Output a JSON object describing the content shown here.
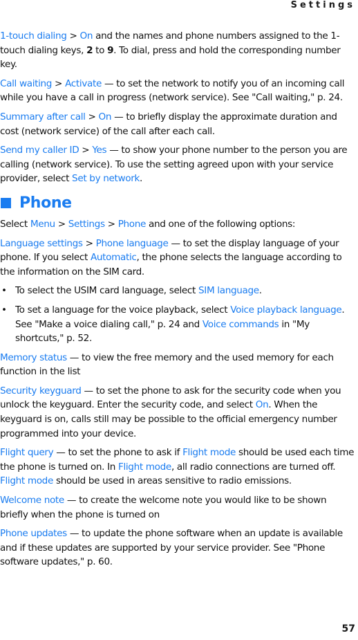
{
  "header": {
    "running_title": "Settings"
  },
  "footer": {
    "page_number": "57"
  },
  "paragraphs": {
    "touch_dialing": {
      "term": "1-touch dialing",
      "sep": " > ",
      "value": "On",
      "text1": " and the names and phone numbers assigned to the 1-touch dialing keys, ",
      "key_from": "2",
      "text2": " to ",
      "key_to": "9",
      "text3": ". To dial, press and hold the corresponding number key."
    },
    "call_waiting": {
      "term": "Call waiting",
      "sep": " > ",
      "value": "Activate",
      "text": " — to set the network to notify you of an incoming call while you have a call in progress (network service). See \"Call waiting,\" p. 24."
    },
    "summary_after_call": {
      "term": "Summary after call",
      "sep": " > ",
      "value": "On",
      "text": " — to briefly display the approximate duration and cost (network service) of the call after each call."
    },
    "send_caller_id": {
      "term": "Send my caller ID",
      "sep": " > ",
      "value": "Yes",
      "text1": " — to show your phone number to the person you are calling (network service). To use the setting agreed upon with your service provider, select ",
      "option": "Set by network",
      "text2": "."
    }
  },
  "section": {
    "heading": "Phone",
    "intro": {
      "text1": "Select ",
      "menu": "Menu",
      "sep": " > ",
      "settings": "Settings",
      "phone": "Phone",
      "text2": " and one of the following options:"
    },
    "language": {
      "term": "Language settings",
      "sep": " > ",
      "value": "Phone language",
      "text1": " — to set the display language of your phone. If you select ",
      "option": "Automatic",
      "text2": ", the phone selects the language according to the information on the SIM card."
    },
    "bullets": [
      {
        "dot": "•",
        "text1": "To select the USIM card language, select ",
        "link1": "SIM language",
        "text2": "."
      },
      {
        "dot": "•",
        "text1": "To set a language for the voice playback, select ",
        "link1": "Voice playback language",
        "text2": ". See \"Make a voice dialing call,\" p. 24 and ",
        "link2": "Voice commands",
        "text3": " in \"My shortcuts,\" p. 52."
      }
    ],
    "memory_status": {
      "term": "Memory status",
      "text": " — to view the free memory and the used memory for each function in the list"
    },
    "security_keyguard": {
      "term": "Security keyguard",
      "text1": " — to set the phone to ask for the security code when you unlock the keyguard. Enter the security code, and select ",
      "option": "On",
      "text2": ". When the keyguard is on, calls still may be possible to the official emergency number programmed into your device."
    },
    "flight_query": {
      "term": "Flight query",
      "text1": " — to set the phone to ask if ",
      "mode1": "Flight mode",
      "text2": " should be used each time the phone is turned on. In ",
      "mode2": "Flight mode",
      "text3": ", all radio connections are turned off. ",
      "mode3": "Flight mode",
      "text4": " should be used in areas sensitive to radio emissions."
    },
    "welcome_note": {
      "term": "Welcome note",
      "text": " — to create the welcome note you would like to be shown briefly when the phone is turned on"
    },
    "phone_updates": {
      "term": "Phone updates",
      "text": " — to update the phone software when an update is available and if these updates are supported by your service provider. See \"Phone software updates,\" p. 60."
    }
  },
  "colors": {
    "accent": "#1a7cf0",
    "body_text": "#111111"
  }
}
